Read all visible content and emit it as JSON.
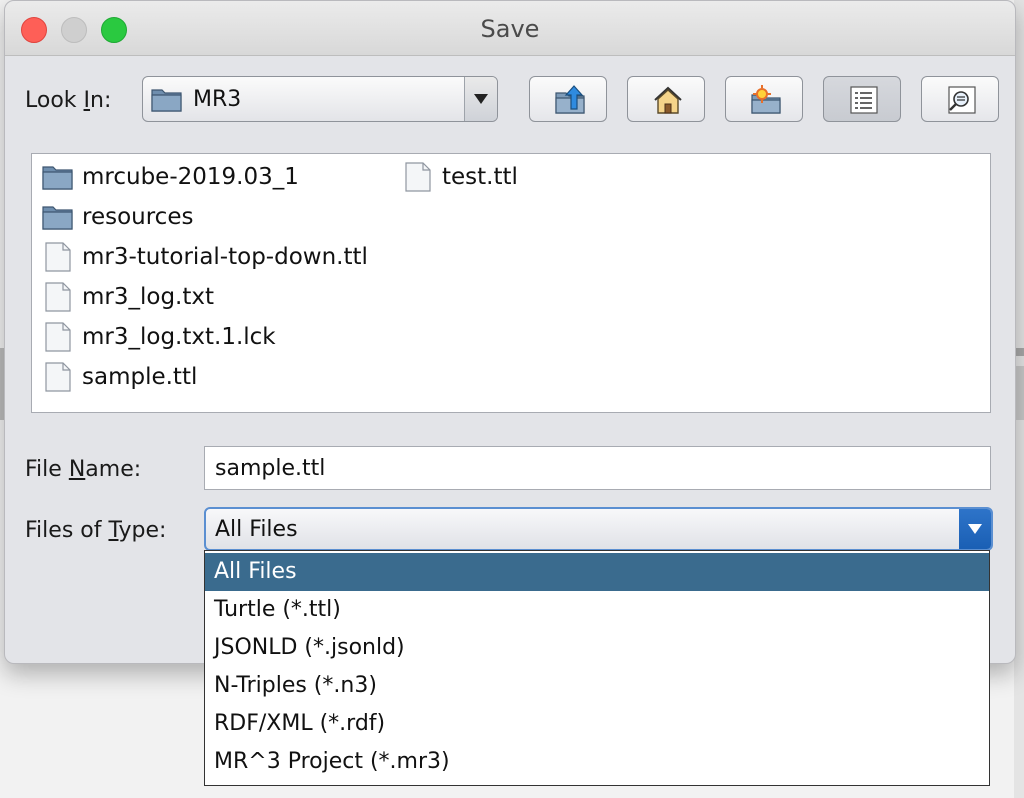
{
  "window": {
    "title": "Save",
    "colors": {
      "close": "#fe5f57",
      "minimize": "#cfcfcf",
      "maximize": "#2ac940"
    }
  },
  "look_in": {
    "label_pre": "Look ",
    "label_mnemonic": "I",
    "label_post": "n:",
    "value": "MR3"
  },
  "toolbar": {
    "buttons": [
      {
        "name": "up-one-level",
        "icon": "folder-up-icon"
      },
      {
        "name": "home",
        "icon": "home-icon"
      },
      {
        "name": "new-folder",
        "icon": "new-folder-icon"
      },
      {
        "name": "list-view",
        "icon": "list-view-icon",
        "active": true
      },
      {
        "name": "details-view",
        "icon": "details-view-icon"
      }
    ]
  },
  "files": {
    "items": [
      {
        "name": "mrcube-2019.03_1",
        "type": "folder"
      },
      {
        "name": "resources",
        "type": "folder"
      },
      {
        "name": "mr3-tutorial-top-down.ttl",
        "type": "file"
      },
      {
        "name": "mr3_log.txt",
        "type": "file"
      },
      {
        "name": "mr3_log.txt.1.lck",
        "type": "file"
      },
      {
        "name": "sample.ttl",
        "type": "file"
      },
      {
        "name": "test.ttl",
        "type": "file"
      }
    ]
  },
  "file_name": {
    "label_pre": "File ",
    "label_mnemonic": "N",
    "label_post": "ame:",
    "value": "sample.ttl"
  },
  "files_of_type": {
    "label_pre": "Files of ",
    "label_mnemonic": "T",
    "label_post": "ype:",
    "selected": "All Files",
    "options": [
      "All Files",
      "Turtle (*.ttl)",
      "JSONLD (*.jsonld)",
      "N-Triples (*.n3)",
      "RDF/XML (*.rdf)",
      "MR^3 Project (*.mr3)"
    ],
    "highlight_color": "#3a6b8e",
    "focus_color": "#5b8fd1"
  }
}
